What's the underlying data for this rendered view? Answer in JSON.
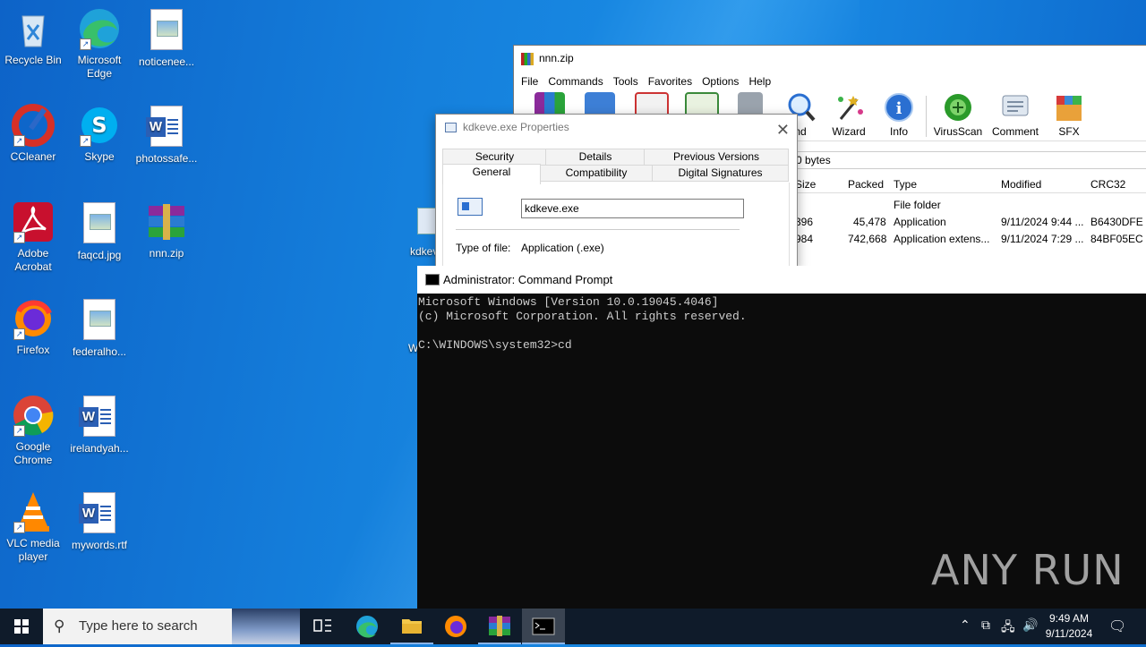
{
  "desktop": {
    "icons": [
      {
        "label": "Recycle Bin",
        "icon": "recycle-bin-icon"
      },
      {
        "label": "Microsoft Edge",
        "icon": "edge-icon"
      },
      {
        "label": "noticenee...",
        "icon": "image-file-icon"
      },
      {
        "label": "CCleaner",
        "icon": "ccleaner-icon"
      },
      {
        "label": "Skype",
        "icon": "skype-icon"
      },
      {
        "label": "photossafe...",
        "icon": "word-doc-icon"
      },
      {
        "label": "Adobe Acrobat",
        "icon": "acrobat-icon"
      },
      {
        "label": "faqcd.jpg",
        "icon": "image-file-icon"
      },
      {
        "label": "nnn.zip",
        "icon": "winrar-archive-icon"
      },
      {
        "label": "Firefox",
        "icon": "firefox-icon"
      },
      {
        "label": "federalho...",
        "icon": "image-file-icon"
      },
      {
        "label": "Google Chrome",
        "icon": "chrome-icon"
      },
      {
        "label": "irelandyah...",
        "icon": "word-doc-icon"
      },
      {
        "label": "VLC media player",
        "icon": "vlc-icon"
      },
      {
        "label": "mywords.rtf",
        "icon": "word-doc-icon"
      }
    ],
    "partial_label_1": "kdkev",
    "partial_label_2": "W"
  },
  "winrar": {
    "title": "nnn.zip",
    "menu": [
      "File",
      "Commands",
      "Tools",
      "Favorites",
      "Options",
      "Help"
    ],
    "toolbar": [
      {
        "label": "nd",
        "icon": "find-icon"
      },
      {
        "label": "Wizard",
        "icon": "wizard-icon"
      },
      {
        "label": "Info",
        "icon": "info-icon"
      },
      {
        "label": "VirusScan",
        "icon": "virusscan-icon"
      },
      {
        "label": "Comment",
        "icon": "comment-icon"
      },
      {
        "label": "SFX",
        "icon": "sfx-icon"
      }
    ],
    "address_text": "0 bytes",
    "columns": [
      "Size",
      "Packed",
      "Type",
      "Modified",
      "CRC32"
    ],
    "rows": [
      {
        "size": "",
        "packed": "",
        "type": "File folder",
        "modified": "",
        "crc": ""
      },
      {
        "size": "396",
        "packed": "45,478",
        "type": "Application",
        "modified": "9/11/2024 9:44 ...",
        "crc": "B6430DFE"
      },
      {
        "size": "984",
        "packed": "742,668",
        "type": "Application extens...",
        "modified": "9/11/2024 7:29 ...",
        "crc": "84BF05EC"
      }
    ]
  },
  "properties": {
    "title": "kdkeve.exe Properties",
    "tabs_row1": [
      "Security",
      "Details",
      "Previous Versions"
    ],
    "tabs_row2": [
      "General",
      "Compatibility",
      "Digital Signatures"
    ],
    "filename": "kdkeve.exe",
    "type_label": "Type of file:",
    "type_value": "Application (.exe)"
  },
  "cmd": {
    "title": "Administrator: Command Prompt",
    "lines": [
      "Microsoft Windows [Version 10.0.19045.4046]",
      "(c) Microsoft Corporation. All rights reserved.",
      "",
      "C:\\WINDOWS\\system32>cd"
    ]
  },
  "watermark": "ANY RUN",
  "taskbar": {
    "search_placeholder": "Type here to search",
    "time": "9:49 AM",
    "date": "9/11/2024"
  }
}
